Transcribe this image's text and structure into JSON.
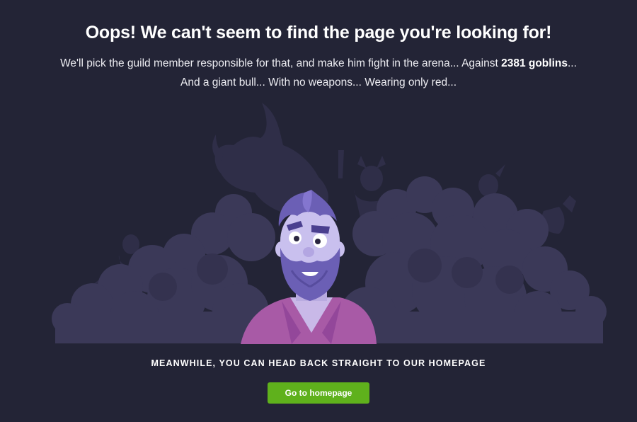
{
  "heading": "Oops! We can't seem to find the page you're looking for!",
  "message": {
    "line1_before": "We'll pick the guild member responsible for that, and make him fight in the arena... Against ",
    "goblin_count": "2381 goblins",
    "line1_after": "...",
    "line2": "And a giant bull... With no weapons... Wearing only red..."
  },
  "cta": {
    "text": "MEANWHILE, YOU CAN HEAD BACK STRAIGHT TO OUR HOMEPAGE",
    "button_label": "Go to homepage"
  },
  "colors": {
    "background": "#232436",
    "crowd": "#3b3958",
    "crowd_dark": "#2f2e48",
    "beard": "#6b5fb5",
    "shirt": "#a85aa6",
    "button": "#5fb11c"
  }
}
